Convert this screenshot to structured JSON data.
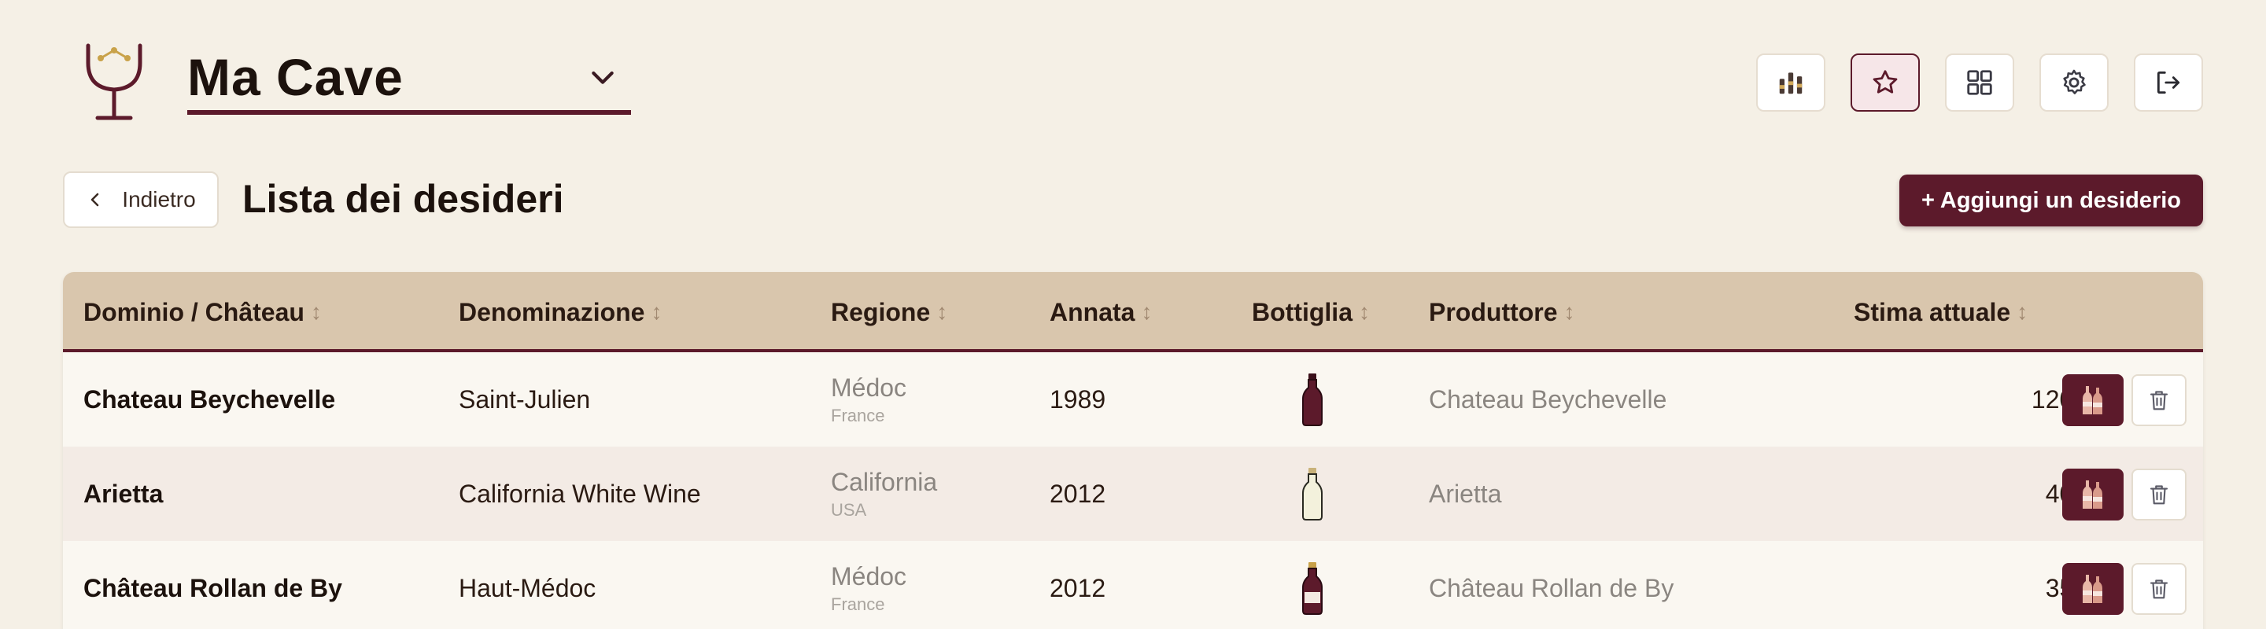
{
  "header": {
    "cellar_name": "Ma Cave",
    "icons": [
      "stats-icon",
      "star-icon",
      "grid-icon",
      "gear-icon",
      "logout-icon"
    ]
  },
  "page": {
    "back_label": "Indietro",
    "title": "Lista dei desideri",
    "add_label": "+ Aggiungi un desiderio"
  },
  "table": {
    "headers": {
      "domain": "Dominio / Château",
      "appellation": "Denominazione",
      "region": "Regione",
      "vintage": "Annata",
      "bottle": "Bottiglia",
      "producer": "Produttore",
      "estimate": "Stima attuale"
    },
    "sort_glyph": "↕",
    "rows": [
      {
        "domain": "Chateau Beychevelle",
        "appellation": "Saint-Julien",
        "region": "Médoc",
        "country": "France",
        "vintage": "1989",
        "bottle_type": "red",
        "producer": "Chateau Beychevelle",
        "estimate": "120 €"
      },
      {
        "domain": "Arietta",
        "appellation": "California White Wine",
        "region": "California",
        "country": "USA",
        "vintage": "2012",
        "bottle_type": "white",
        "producer": "Arietta",
        "estimate": "40 €"
      },
      {
        "domain": "Château Rollan de By",
        "appellation": "Haut-Médoc",
        "region": "Médoc",
        "country": "France",
        "vintage": "2012",
        "bottle_type": "red",
        "producer": "Château Rollan de By",
        "estimate": "35 €"
      }
    ]
  },
  "colors": {
    "accent": "#5c1a2b",
    "header_bg": "#d9c6ad",
    "page_bg": "#f5f0e6"
  }
}
